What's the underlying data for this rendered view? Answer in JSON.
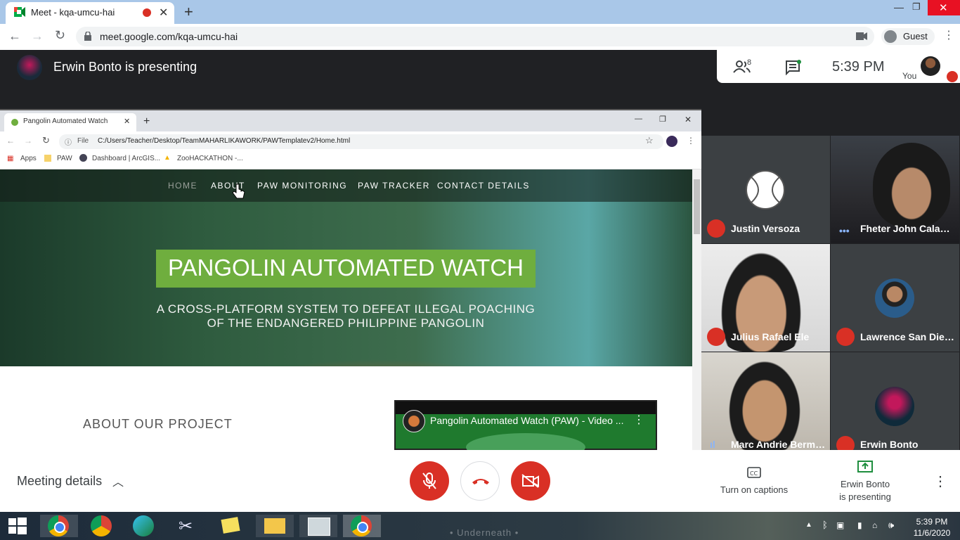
{
  "browser": {
    "tab_title": "Meet - kqa-umcu-hai",
    "url": "meet.google.com/kqa-umcu-hai",
    "profile_label": "Guest"
  },
  "meet": {
    "presenting_banner": "Erwin Bonto is presenting",
    "participants_count": "8",
    "time": "5:39  PM",
    "you_label": "You"
  },
  "shared_screen": {
    "tab_title": "Pangolin Automated Watch",
    "file_label": "File",
    "url": "C:/Users/Teacher/Desktop/TeamMAHARLIKAWORK/PAWTemplatev2/Home.html",
    "bookmarks": [
      "Apps",
      "PAW",
      "Dashboard | ArcGIS...",
      "ZooHACKATHON -..."
    ],
    "nav": [
      "HOME",
      "ABOUT",
      "PAW MONITORING",
      "PAW TRACKER",
      "CONTACT DETAILS"
    ],
    "title": "PANGOLIN AUTOMATED WATCH",
    "subtitle_line1": "A CROSS-PLATFORM SYSTEM TO DEFEAT ILLEGAL POACHING",
    "subtitle_line2": "OF THE ENDANGERED PHILIPPINE PANGOLIN",
    "about_heading": "ABOUT OUR PROJECT",
    "video_title": "Pangolin Automated Watch (PAW) - Video ..."
  },
  "participants": [
    {
      "name": "Justin Versoza",
      "status": "muted"
    },
    {
      "name": "Fheter John Caland...",
      "status": "speaking"
    },
    {
      "name": "Julius Rafael Ele",
      "status": "muted"
    },
    {
      "name": "Lawrence San Diego",
      "status": "muted"
    },
    {
      "name": "Marc Andrie Bermu...",
      "status": "speaking"
    },
    {
      "name": "Erwin Bonto",
      "status": "muted"
    }
  ],
  "bottom": {
    "meeting_details": "Meeting details",
    "captions": "Turn on captions",
    "presenting_line1": "Erwin Bonto",
    "presenting_line2": "is presenting"
  },
  "taskbar": {
    "time": "5:39 PM",
    "date": "11/6/2020",
    "wallpaper_text": "• Underneath •"
  },
  "colors": {
    "meet_red": "#d93025",
    "paw_green": "#6fae3e",
    "meet_dark": "#202124"
  }
}
